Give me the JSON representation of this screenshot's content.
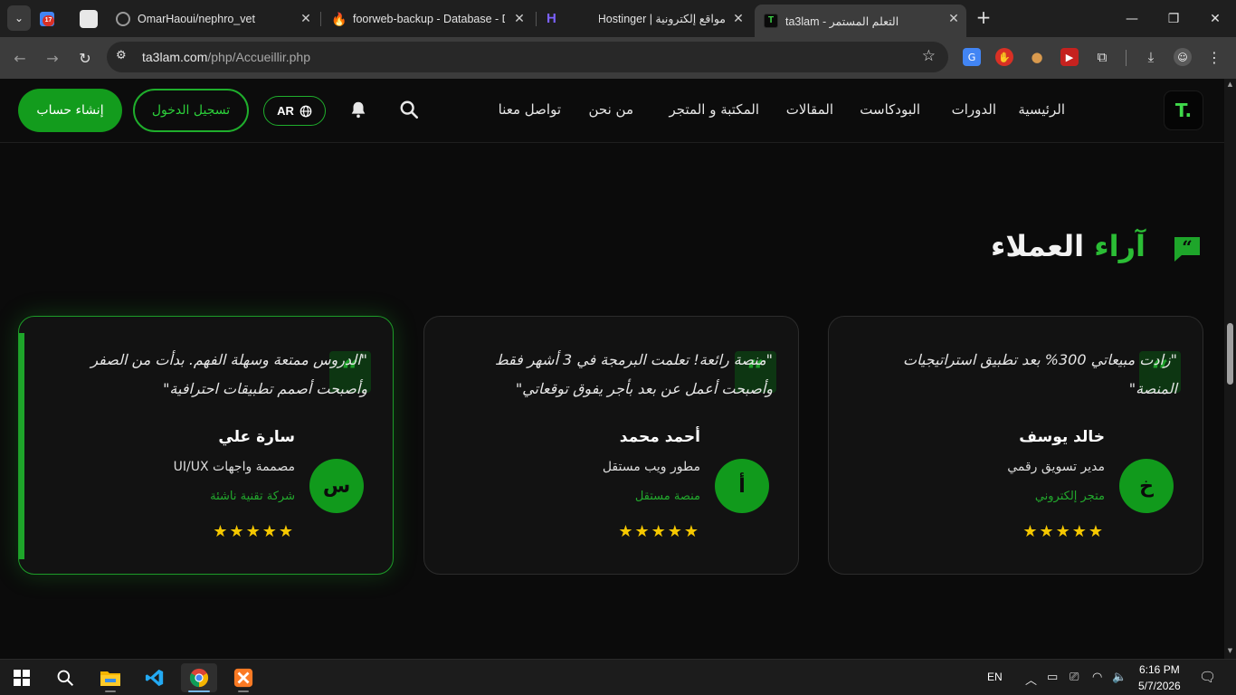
{
  "browser": {
    "tab_badge": "17",
    "tabs": [
      {
        "title": "OmarHaoui/nephro_vet"
      },
      {
        "title": "foorweb-backup - Database - D"
      },
      {
        "title": "مواقع إلكترونية | Hostinger"
      },
      {
        "title": "ta3lam - التعلم المستمر"
      }
    ],
    "url_host": "ta3lam.com",
    "url_path": "/php/Accueillir.php"
  },
  "site": {
    "logo_text": "T.",
    "nav": [
      "الرئيسية",
      "الدورات",
      "البودكاست",
      "المقالات",
      "المكتبة و المتجر",
      "من نحن",
      "تواصل معنا"
    ],
    "lang_label": "AR",
    "login_label": "تسجيل الدخول",
    "signup_label": "إنشاء حساب"
  },
  "testimonials": {
    "title_green": "آراء",
    "title_white": "العملاء",
    "cards": [
      {
        "quote": "\"زادت مبيعاتي 300% بعد تطبيق استراتيجيات المنصة\"",
        "name": "خالد يوسف",
        "role": "مدير تسويق رقمي",
        "company": "متجر إلكتروني",
        "initial": "خ",
        "stars": "★★★★★",
        "rating": 5
      },
      {
        "quote": "\"منصة رائعة! تعلمت البرمجة في 3 أشهر فقط وأصبحت أعمل عن بعد بأجر يفوق توقعاتي\"",
        "name": "أحمد محمد",
        "role": "مطور ويب مستقل",
        "company": "منصة مستقل",
        "initial": "أ",
        "stars": "★★★★★",
        "rating": 5
      },
      {
        "quote": "\"الدروس ممتعة وسهلة الفهم. بدأت من الصفر وأصبحت أصمم تطبيقات احترافية\"",
        "name": "سارة علي",
        "role": "مصممة واجهات UI/UX",
        "company": "شركة تقنية ناشئة",
        "initial": "س",
        "stars": "★★★★★",
        "rating": 5
      }
    ]
  },
  "taskbar": {
    "lang": "EN",
    "time": "6:16 PM",
    "date": "5/7/2026"
  },
  "colors": {
    "accent": "#1fae2c",
    "star": "#f6c800",
    "background": "#0b0b0b"
  }
}
